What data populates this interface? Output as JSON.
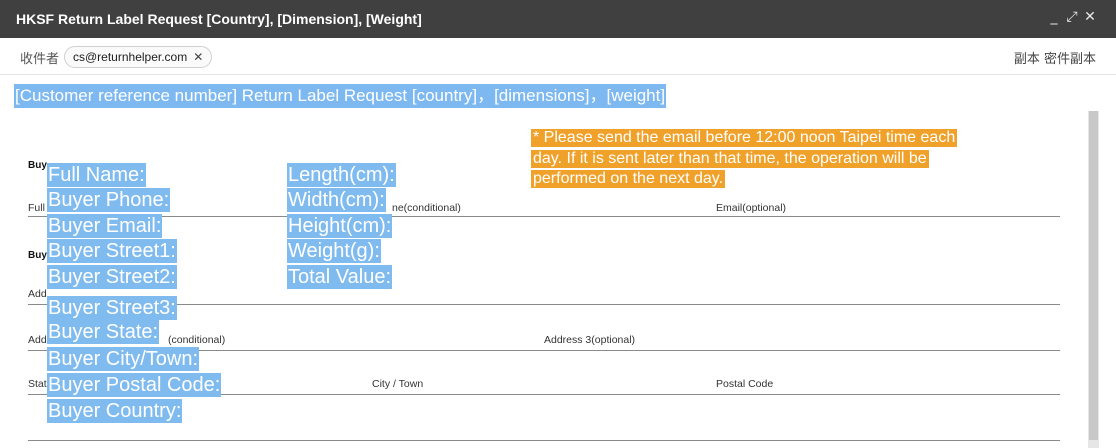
{
  "window": {
    "title": "HKSF Return Label Request [Country], [Dimension], [Weight]",
    "minimize_icon": "minimize-icon",
    "expand_icon": "expand-icon",
    "close_icon": "close-icon"
  },
  "recipients": {
    "to_label": "收件者",
    "to_address": "cs@returnhelper.com",
    "cc_bcc": "副本 密件副本"
  },
  "subject": "[Customer reference number] Return Label Request [country]，[dimensions]，[weight]",
  "form": {
    "buyer_section_1": "Buy",
    "full_label": "Full",
    "phone_label_partial": "ne(conditional)",
    "email_label": "Email(optional)",
    "buyer_section_2": "Buy",
    "address_label_1": "Add",
    "address_label_2": "Add",
    "address2_partial": "(conditional)",
    "address3_label": "Address 3(optional)",
    "state_label": "Stat",
    "city_label": "City / Town",
    "postal_label": "Postal Code"
  },
  "buyer_fields": [
    "Full Name:",
    "Buyer Phone:",
    "Buyer Email:",
    "Buyer Street1:",
    "Buyer Street2:",
    "Buyer Street3:",
    "Buyer State:",
    "Buyer City/Town:",
    "Buyer Postal Code:",
    "Buyer Country:"
  ],
  "package_fields": [
    "Length(cm):",
    "Width(cm):",
    "Height(cm):",
    "Weight(g):",
    "Total Value:"
  ],
  "notice": [
    " * Please send the email before 12:00 noon Taipei time each",
    "day. If it is sent later than that time, the operation will be",
    "performed on the next day."
  ],
  "colors": {
    "titlebar": "#404040",
    "selection_highlight": "#80bbef",
    "notice_highlight": "#f0a12a"
  }
}
